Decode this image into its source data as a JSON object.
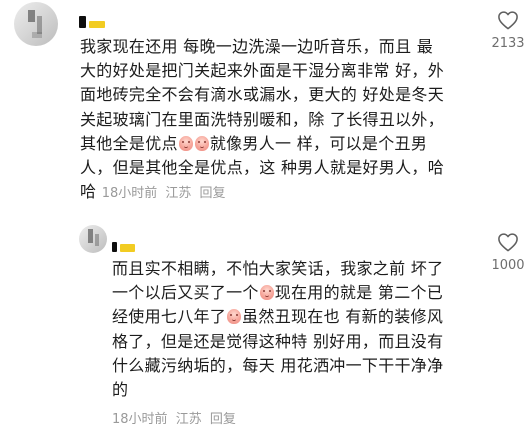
{
  "comment": {
    "lines": [
      "我家现在还用 每晚一边洗澡一边听音乐，而且",
      "最大的好处是把门关起来外面是干湿分离非常",
      "好，外面地砖完全不会有滴水或漏水，更大的",
      "好处是冬天关起玻璃门在里面洗特别暖和，除",
      "了长得丑以外，其他全是优点",
      "就像男人一",
      "样，可以是个丑男人，但是其他全是优点，这",
      "种男人就是好男人，哈哈"
    ],
    "time": "18小时前",
    "location": "江苏",
    "reply_label": "回复",
    "likes": "2133",
    "emoji_icon": "peach-face-emoji"
  },
  "reply": {
    "lines": [
      "而且实不相瞒，不怕大家笑话，我家之前",
      "坏了一个以后又买了一个",
      "现在用的就是",
      "第二个已经使用七八年了",
      "虽然丑现在也",
      "有新的装修风格了，但是还是觉得这种特",
      "别好用，而且没有什么藏污纳垢的，每天",
      "用花洒冲一下干干净净的"
    ],
    "time": "18小时前",
    "location": "江苏",
    "reply_label": "回复",
    "likes": "1000",
    "emoji_icon": "peach-face-emoji"
  },
  "colors": {
    "username_accent": "#f2cc22",
    "meta_text": "#9a9a9a",
    "like_count": "#6e6e6e"
  },
  "icons": {
    "like": "heart-outline-icon"
  }
}
